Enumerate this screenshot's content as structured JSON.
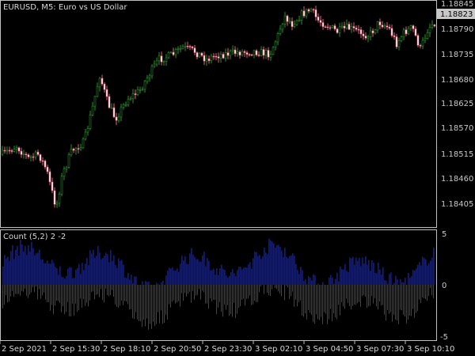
{
  "main_chart": {
    "title": "EURUSD, M5:  Euro vs US Dollar",
    "price_labels": [
      "1.18845",
      "1.18790",
      "1.18735",
      "1.18680",
      "1.18625",
      "1.18570",
      "1.18515",
      "1.18460",
      "1.18405"
    ],
    "current_price": "1.18823"
  },
  "indicator": {
    "title": "Count (5,2) 2 -2",
    "scale_labels": [
      "5",
      "0",
      "-5"
    ]
  },
  "time_axis": {
    "labels": [
      "2 Sep 2021",
      "2 Sep 15:30",
      "2 Sep 18:10",
      "2 Sep 20:50",
      "2 Sep 23:30",
      "3 Sep 02:10",
      "3 Sep 04:50",
      "3 Sep 07:30",
      "3 Sep 10:10"
    ]
  },
  "colors": {
    "background": "#000000",
    "frame": "#c0c0c0",
    "candle_up": "#2e8b2e",
    "candle_down": "#e0607a",
    "candle_body_up": "#000000",
    "candle_body_down": "#ffffff",
    "hist_positive": "#0f1a9a",
    "hist_negative": "#c01010",
    "current_price_box": "#c8c8c8"
  },
  "chart_data": {
    "type": "candlestick",
    "series": [
      {
        "name": "EURUSD, M5",
        "price_range": [
          1.1838,
          1.1886
        ]
      },
      {
        "name": "Count (5,2)",
        "y_range": [
          -5,
          5
        ]
      }
    ]
  }
}
